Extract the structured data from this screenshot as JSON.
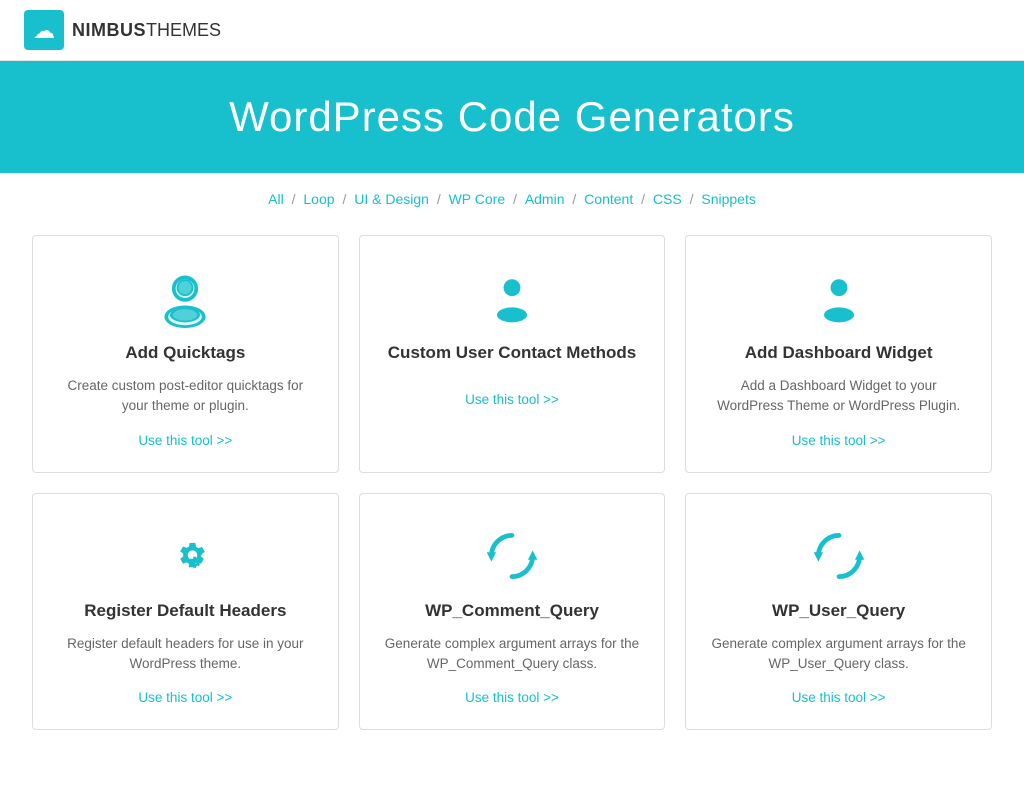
{
  "navbar": {
    "logo_text_bold": "NIMBUS",
    "logo_text_light": "THEMES"
  },
  "hero": {
    "title": "WordPress Code Generators"
  },
  "breadcrumb": {
    "items": [
      {
        "label": "All",
        "active": true
      },
      {
        "label": "Loop"
      },
      {
        "label": "UI & Design"
      },
      {
        "label": "WP Core"
      },
      {
        "label": "Admin"
      },
      {
        "label": "Content"
      },
      {
        "label": "CSS"
      },
      {
        "label": "Snippets"
      }
    ]
  },
  "cards": [
    {
      "id": "add-quicktags",
      "icon_type": "user",
      "title": "Add Quicktags",
      "description": "Create custom post-editor quicktags for your theme or plugin.",
      "link_label": "Use this tool >>"
    },
    {
      "id": "custom-user-contact",
      "icon_type": "user",
      "title": "Custom User Contact Methods",
      "description": "",
      "link_label": "Use this tool >>"
    },
    {
      "id": "add-dashboard-widget",
      "icon_type": "user",
      "title": "Add Dashboard Widget",
      "description": "Add a Dashboard Widget to your WordPress Theme or WordPress Plugin.",
      "link_label": "Use this tool >>"
    },
    {
      "id": "register-default-headers",
      "icon_type": "gear",
      "title": "Register Default Headers",
      "description": "Register default headers for use in your WordPress theme.",
      "link_label": "Use this tool >>"
    },
    {
      "id": "wp-comment-query",
      "icon_type": "refresh",
      "title": "WP_Comment_Query",
      "description": "Generate complex argument arrays for the WP_Comment_Query class.",
      "link_label": "Use this tool >>"
    },
    {
      "id": "wp-user-query",
      "icon_type": "refresh",
      "title": "WP_User_Query",
      "description": "Generate complex argument arrays for the WP_User_Query class.",
      "link_label": "Use this tool >>"
    }
  ],
  "accent_color": "#17c0cc"
}
